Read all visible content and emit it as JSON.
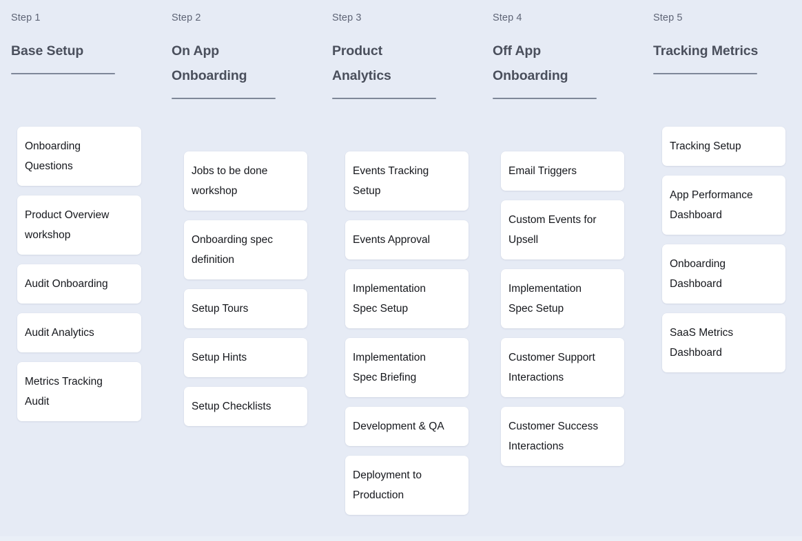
{
  "theme": {
    "background": "#e6ebf5",
    "card_background": "#ffffff",
    "step_label_color": "#5e6475",
    "step_title_color": "#4a4f5c",
    "divider_color": "#7e8798",
    "card_text_color": "#15171c"
  },
  "columns": [
    {
      "step_label": "Step 1",
      "title": "Base\nSetup",
      "cards": [
        "Onboarding\nQuestions",
        "Product Overview\nworkshop",
        "Audit Onboarding",
        "Audit Analytics",
        "Metrics Tracking\nAudit"
      ]
    },
    {
      "step_label": "Step 2",
      "title": "On App\nOnboarding",
      "cards": [
        "Jobs to be done\nworkshop",
        "Onboarding spec\ndefinition",
        "Setup Tours",
        "Setup Hints",
        "Setup Checklists"
      ]
    },
    {
      "step_label": "Step 3",
      "title": "Product\nAnalytics",
      "cards": [
        "Events Tracking\nSetup",
        "Events Approval",
        "Implementation\nSpec Setup",
        "Implementation\nSpec Briefing",
        "Development & QA",
        "Deployment to\nProduction"
      ]
    },
    {
      "step_label": "Step 4",
      "title": "Off App\nOnboarding",
      "cards": [
        "Email Triggers",
        "Custom Events for\nUpsell",
        "Implementation\nSpec Setup",
        "Customer Support\nInteractions",
        "Customer Success\nInteractions"
      ]
    },
    {
      "step_label": "Step 5",
      "title": "Tracking\nMetrics",
      "cards": [
        "Tracking Setup",
        "App Performance\nDashboard",
        "Onboarding\nDashboard",
        "SaaS Metrics\nDashboard"
      ]
    }
  ]
}
